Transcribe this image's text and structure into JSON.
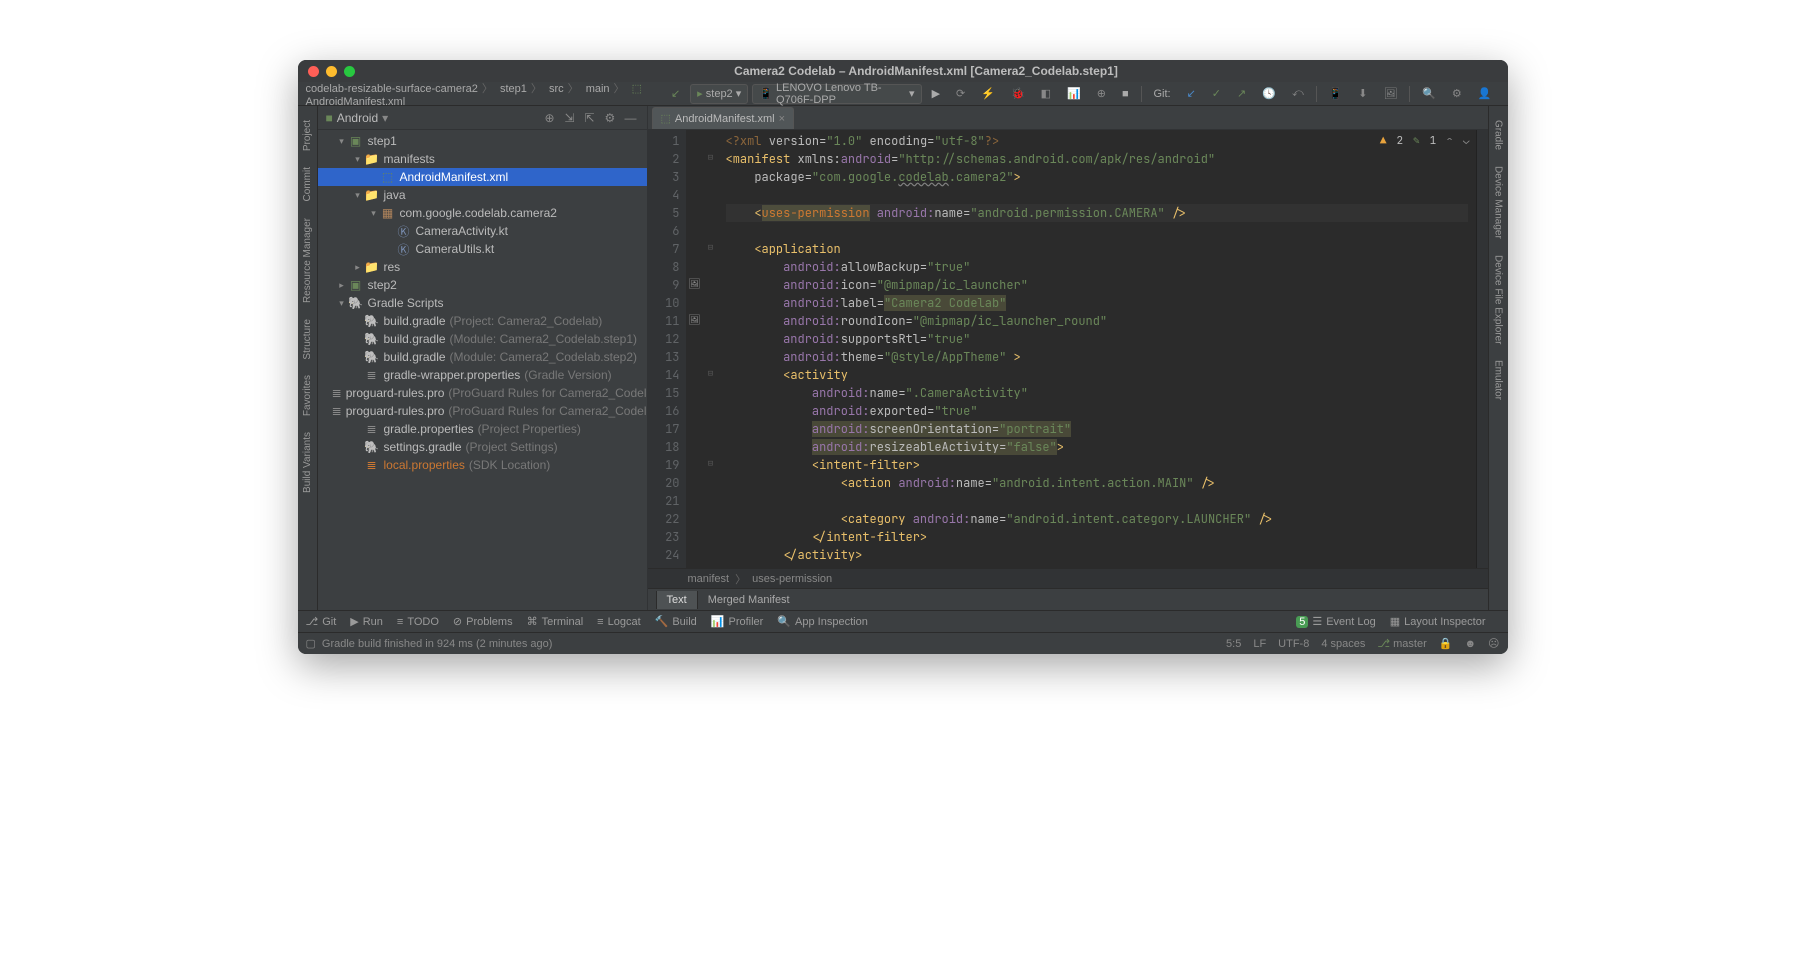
{
  "window_title": "Camera2 Codelab – AndroidManifest.xml [Camera2_Codelab.step1]",
  "breadcrumbs": [
    "codelab-resizable-surface-camera2",
    "step1",
    "src",
    "main",
    "AndroidManifest.xml"
  ],
  "run_config": "step2",
  "device": "LENOVO Lenovo TB-Q706F-DPP",
  "vcs_label": "Git:",
  "project_panel": {
    "view": "Android",
    "tree": [
      {
        "depth": 0,
        "expander": "▾",
        "icon": "module",
        "label": "step1"
      },
      {
        "depth": 1,
        "expander": "▾",
        "icon": "folder",
        "label": "manifests"
      },
      {
        "depth": 2,
        "expander": "",
        "icon": "xml",
        "label": "AndroidManifest.xml",
        "selected": true
      },
      {
        "depth": 1,
        "expander": "▾",
        "icon": "folder",
        "label": "java"
      },
      {
        "depth": 2,
        "expander": "▾",
        "icon": "package",
        "label": "com.google.codelab.camera2"
      },
      {
        "depth": 3,
        "expander": "",
        "icon": "kt",
        "label": "CameraActivity.kt"
      },
      {
        "depth": 3,
        "expander": "",
        "icon": "kt",
        "label": "CameraUtils.kt"
      },
      {
        "depth": 1,
        "expander": "▸",
        "icon": "folder",
        "label": "res"
      },
      {
        "depth": 0,
        "expander": "▸",
        "icon": "module",
        "label": "step2"
      },
      {
        "depth": 0,
        "expander": "▾",
        "icon": "gradle",
        "label": "Gradle Scripts"
      },
      {
        "depth": 1,
        "expander": "",
        "icon": "gradle",
        "label": "build.gradle",
        "hint": "(Project: Camera2_Codelab)"
      },
      {
        "depth": 1,
        "expander": "",
        "icon": "gradle",
        "label": "build.gradle",
        "hint": "(Module: Camera2_Codelab.step1)"
      },
      {
        "depth": 1,
        "expander": "",
        "icon": "gradle",
        "label": "build.gradle",
        "hint": "(Module: Camera2_Codelab.step2)"
      },
      {
        "depth": 1,
        "expander": "",
        "icon": "props",
        "label": "gradle-wrapper.properties",
        "hint": "(Gradle Version)"
      },
      {
        "depth": 1,
        "expander": "",
        "icon": "pro",
        "label": "proguard-rules.pro",
        "hint": "(ProGuard Rules for Camera2_Codel"
      },
      {
        "depth": 1,
        "expander": "",
        "icon": "pro",
        "label": "proguard-rules.pro",
        "hint": "(ProGuard Rules for Camera2_Codel"
      },
      {
        "depth": 1,
        "expander": "",
        "icon": "props",
        "label": "gradle.properties",
        "hint": "(Project Properties)"
      },
      {
        "depth": 1,
        "expander": "",
        "icon": "gradle",
        "label": "settings.gradle",
        "hint": "(Project Settings)"
      },
      {
        "depth": 1,
        "expander": "",
        "icon": "local",
        "label": "local.properties",
        "hint": "(SDK Location)",
        "warn": true
      }
    ]
  },
  "left_rail": [
    "Project",
    "Commit",
    "Resource Manager",
    "Structure",
    "Favorites",
    "Build Variants"
  ],
  "right_rail": [
    "Gradle",
    "Device Manager",
    "Device File Explorer",
    "Emulator"
  ],
  "editor": {
    "tab_name": "AndroidManifest.xml",
    "inspections": {
      "warnings": "2",
      "typos": "1"
    },
    "lines": [
      {
        "n": 1,
        "fold": "",
        "html": "<span class='c-pi'>&lt;?xml</span> <span class='c-attr'>version</span>=<span class='c-str'>\"1.0\"</span> <span class='c-attr'>encoding</span>=<span class='c-str'>\"utf-8\"</span><span class='c-pi'>?&gt;</span>"
      },
      {
        "n": 2,
        "fold": "⊟",
        "html": "<span class='c-br'>&lt;</span><span class='c-tag'>manifest</span> <span class='c-attr'>xmlns:</span><span class='c-ns'>android</span>=<span class='c-str'>\"http://schemas.android.com/apk/res/android\"</span>"
      },
      {
        "n": 3,
        "fold": "",
        "html": "    <span class='c-attr'>package</span>=<span class='c-str'>\"com.google.<span class='underwave'>codelab</span>.camera2\"</span><span class='c-br'>&gt;</span>"
      },
      {
        "n": 4,
        "fold": "",
        "html": ""
      },
      {
        "n": 5,
        "fold": "",
        "cur": true,
        "html": "    <span class='c-br'>&lt;</span><span class='c-key hl'>uses-permission</span> <span class='c-ns'>android:</span><span class='c-attr'>name</span>=<span class='c-str'>\"android.permission.CAMERA\"</span> <span class='c-br'>/&gt;</span>"
      },
      {
        "n": 6,
        "fold": "",
        "html": ""
      },
      {
        "n": 7,
        "fold": "⊟",
        "html": "    <span class='c-br'>&lt;</span><span class='c-tag'>application</span>"
      },
      {
        "n": 8,
        "fold": "",
        "html": "        <span class='c-ns'>android:</span><span class='c-attr'>allowBackup</span>=<span class='c-str'>\"true\"</span>"
      },
      {
        "n": 9,
        "fold": "",
        "mark": "img",
        "html": "        <span class='c-ns'>android:</span><span class='c-attr'>icon</span>=<span class='c-str'>\"@mipmap/ic_launcher\"</span>"
      },
      {
        "n": 10,
        "fold": "",
        "html": "        <span class='c-ns'>android:</span><span class='c-attr'>label</span>=<span class='c-str hl'>\"Camera2 Codelab\"</span>"
      },
      {
        "n": 11,
        "fold": "",
        "mark": "img",
        "html": "        <span class='c-ns'>android:</span><span class='c-attr'>roundIcon</span>=<span class='c-str'>\"@mipmap/ic_launcher_round\"</span>"
      },
      {
        "n": 12,
        "fold": "",
        "html": "        <span class='c-ns'>android:</span><span class='c-attr'>supportsRtl</span>=<span class='c-str'>\"true\"</span>"
      },
      {
        "n": 13,
        "fold": "",
        "html": "        <span class='c-ns'>android:</span><span class='c-attr'>theme</span>=<span class='c-str'>\"@style/AppTheme\"</span> <span class='c-br'>&gt;</span>"
      },
      {
        "n": 14,
        "fold": "⊟",
        "html": "        <span class='c-br'>&lt;</span><span class='c-tag'>activity</span>"
      },
      {
        "n": 15,
        "fold": "",
        "html": "            <span class='c-ns'>android:</span><span class='c-attr'>name</span>=<span class='c-str'>\".CameraActivity\"</span>"
      },
      {
        "n": 16,
        "fold": "",
        "html": "            <span class='c-ns'>android:</span><span class='c-attr'>exported</span>=<span class='c-str'>\"true\"</span>"
      },
      {
        "n": 17,
        "fold": "",
        "html": "            <span class='hl'><span class='c-ns'>android:</span><span class='c-attr'>screenOrientation</span>=<span class='c-str'>\"portrait\"</span></span>"
      },
      {
        "n": 18,
        "fold": "",
        "html": "            <span class='hl'><span class='c-ns'>android:</span><span class='c-attr'>resizeableActivity</span>=<span class='c-str'>\"false\"</span></span><span class='c-br'>&gt;</span>"
      },
      {
        "n": 19,
        "fold": "⊟",
        "html": "            <span class='c-br'>&lt;</span><span class='c-tag'>intent-filter</span><span class='c-br'>&gt;</span>"
      },
      {
        "n": 20,
        "fold": "",
        "html": "                <span class='c-br'>&lt;</span><span class='c-tag'>action</span> <span class='c-ns'>android:</span><span class='c-attr'>name</span>=<span class='c-str'>\"android.intent.action.MAIN\"</span> <span class='c-br'>/&gt;</span>"
      },
      {
        "n": 21,
        "fold": "",
        "html": ""
      },
      {
        "n": 22,
        "fold": "",
        "html": "                <span class='c-br'>&lt;</span><span class='c-tag'>category</span> <span class='c-ns'>android:</span><span class='c-attr'>name</span>=<span class='c-str'>\"android.intent.category.LAUNCHER\"</span> <span class='c-br'>/&gt;</span>"
      },
      {
        "n": 23,
        "fold": "",
        "html": "            <span class='c-br'>&lt;/</span><span class='c-tag'>intent-filter</span><span class='c-br'>&gt;</span>"
      },
      {
        "n": 24,
        "fold": "",
        "html": "        <span class='c-br'>&lt;/</span><span class='c-tag'>activity</span><span class='c-br'>&gt;</span>"
      }
    ],
    "breadcrumb": [
      "manifest",
      "uses-permission"
    ],
    "bottom_tabs": [
      "Text",
      "Merged Manifest"
    ]
  },
  "tool_windows": {
    "left": [
      "Git",
      "Run",
      "TODO",
      "Problems",
      "Terminal",
      "Logcat",
      "Build",
      "Profiler",
      "App Inspection"
    ],
    "right": [
      "Event Log",
      "Layout Inspector"
    ]
  },
  "status": {
    "message": "Gradle build finished in 924 ms (2 minutes ago)",
    "caret": "5:5",
    "line_sep": "LF",
    "encoding": "UTF-8",
    "indent": "4 spaces",
    "branch": "master"
  }
}
